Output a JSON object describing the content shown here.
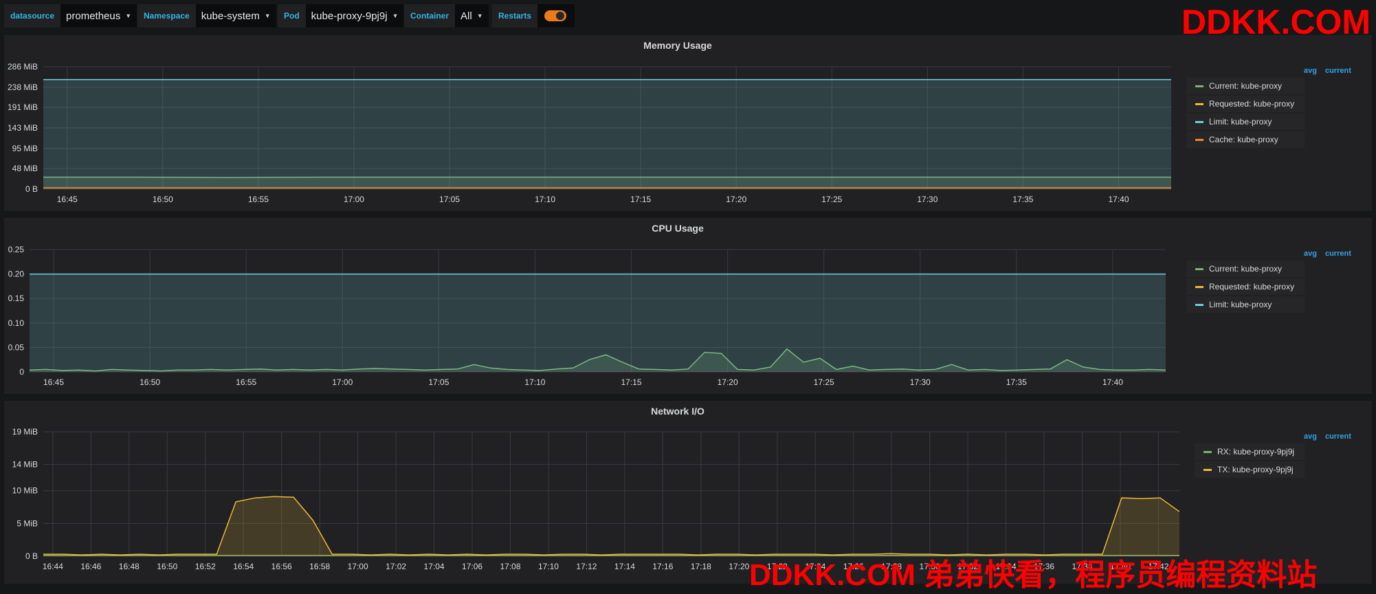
{
  "variables": {
    "datasource": {
      "label": "datasource",
      "value": "prometheus"
    },
    "namespace": {
      "label": "Namespace",
      "value": "kube-system"
    },
    "pod": {
      "label": "Pod",
      "value": "kube-proxy-9pj9j"
    },
    "container": {
      "label": "Container",
      "value": "All"
    },
    "restarts": {
      "label": "Restarts",
      "enabled": true
    }
  },
  "watermark": {
    "top": "DDKK.COM",
    "bottom": "DDKK.COM 弟弟快看，程序员编程资料站"
  },
  "legend_columns": {
    "avg": "avg",
    "current": "current"
  },
  "colors": {
    "green": "#7eb26d",
    "yellow": "#eab839",
    "blue": "#6ed0e0",
    "orange": "#ef843c",
    "accent": "#33b5e5"
  },
  "chart_data": [
    {
      "type": "line",
      "title": "Memory Usage",
      "ylim": [
        0,
        286
      ],
      "ytick_labels": [
        "0 B",
        "48 MiB",
        "95 MiB",
        "143 MiB",
        "191 MiB",
        "238 MiB",
        "286 MiB"
      ],
      "ytick_values": [
        0,
        48,
        95,
        143,
        191,
        238,
        286
      ],
      "xtick_labels": [
        "16:45",
        "16:50",
        "16:55",
        "17:00",
        "17:05",
        "17:10",
        "17:15",
        "17:20",
        "17:25",
        "17:30",
        "17:35",
        "17:40"
      ],
      "series": [
        {
          "name": "Current: kube-proxy",
          "color": "#7eb26d",
          "values": [
            28,
            28,
            27,
            28,
            28,
            28,
            28,
            28,
            28,
            28,
            28,
            28,
            28
          ]
        },
        {
          "name": "Requested: kube-proxy",
          "color": "#eab839",
          "values": []
        },
        {
          "name": "Limit: kube-proxy",
          "color": "#6ed0e0",
          "values": [
            256,
            256,
            256,
            256,
            256,
            256,
            256,
            256,
            256,
            256,
            256,
            256,
            256
          ]
        },
        {
          "name": "Cache: kube-proxy",
          "color": "#ef843c",
          "values": [
            3,
            3,
            3,
            3,
            3,
            3,
            3,
            3,
            3,
            3,
            3,
            3,
            3
          ]
        }
      ]
    },
    {
      "type": "line",
      "title": "CPU Usage",
      "ylim": [
        0,
        0.25
      ],
      "ytick_labels": [
        "0",
        "0.05",
        "0.10",
        "0.15",
        "0.20",
        "0.25"
      ],
      "ytick_values": [
        0,
        0.05,
        0.1,
        0.15,
        0.2,
        0.25
      ],
      "xtick_labels": [
        "16:45",
        "16:50",
        "16:55",
        "17:00",
        "17:05",
        "17:10",
        "17:15",
        "17:20",
        "17:25",
        "17:30",
        "17:35",
        "17:40"
      ],
      "series": [
        {
          "name": "Current: kube-proxy",
          "color": "#7eb26d",
          "values": [
            0.004,
            0.005,
            0.003,
            0.004,
            0.002,
            0.005,
            0.004,
            0.003,
            0.002,
            0.004,
            0.004,
            0.005,
            0.004,
            0.005,
            0.006,
            0.004,
            0.005,
            0.004,
            0.005,
            0.004,
            0.006,
            0.007,
            0.006,
            0.005,
            0.004,
            0.005,
            0.006,
            0.015,
            0.008,
            0.005,
            0.004,
            0.003,
            0.006,
            0.008,
            0.025,
            0.035,
            0.02,
            0.006,
            0.005,
            0.004,
            0.006,
            0.04,
            0.038,
            0.005,
            0.004,
            0.01,
            0.047,
            0.02,
            0.028,
            0.005,
            0.012,
            0.004,
            0.005,
            0.006,
            0.004,
            0.005,
            0.015,
            0.004,
            0.005,
            0.003,
            0.004,
            0.005,
            0.006,
            0.025,
            0.01,
            0.005,
            0.004,
            0.004,
            0.005,
            0.004
          ]
        },
        {
          "name": "Requested: kube-proxy",
          "color": "#eab839",
          "values": []
        },
        {
          "name": "Limit: kube-proxy",
          "color": "#6ed0e0",
          "values": [
            0.2,
            0.2,
            0.2,
            0.2,
            0.2,
            0.2,
            0.2,
            0.2,
            0.2,
            0.2,
            0.2,
            0.2,
            0.2
          ]
        }
      ]
    },
    {
      "type": "area",
      "title": "Network I/O",
      "ylim": [
        0,
        19
      ],
      "ytick_labels": [
        "0 B",
        "5 MiB",
        "10 MiB",
        "14 MiB",
        "19 MiB"
      ],
      "ytick_values": [
        0,
        5,
        10,
        14,
        19
      ],
      "xtick_labels": [
        "16:44",
        "16:46",
        "16:48",
        "16:50",
        "16:52",
        "16:54",
        "16:56",
        "16:58",
        "17:00",
        "17:02",
        "17:04",
        "17:06",
        "17:08",
        "17:10",
        "17:12",
        "17:14",
        "17:16",
        "17:18",
        "17:20",
        "17:22",
        "17:24",
        "17:26",
        "17:28",
        "17:30",
        "17:32",
        "17:34",
        "17:36",
        "17:38",
        "17:40",
        "17:42"
      ],
      "series": [
        {
          "name": "RX: kube-proxy-9pj9j",
          "color": "#7eb26d",
          "values": [
            0.1,
            0.1,
            0.1,
            0.1,
            0.1,
            0.1,
            0.1,
            0.1,
            0.1,
            0.1,
            0.1,
            0.1,
            0.1,
            0.1,
            0.1,
            0.1,
            0.1,
            0.1,
            0.1,
            0.1,
            0.1,
            0.1,
            0.1,
            0.1,
            0.1,
            0.1,
            0.1,
            0.1,
            0.1,
            0.1,
            0.1,
            0.1,
            0.1,
            0.1,
            0.1,
            0.1,
            0.1,
            0.1,
            0.1,
            0.1,
            0.1,
            0.1,
            0.1,
            0.1,
            0.1,
            0.1,
            0.1,
            0.1,
            0.1,
            0.1,
            0.1,
            0.1,
            0.1,
            0.1,
            0.1,
            0.1,
            0.1,
            0.1,
            0.1,
            0.1
          ]
        },
        {
          "name": "TX: kube-proxy-9pj9j",
          "color": "#eab839",
          "values": [
            0.3,
            0.3,
            0.2,
            0.3,
            0.2,
            0.3,
            0.2,
            0.3,
            0.3,
            0.3,
            8.3,
            8.9,
            9.1,
            9.0,
            5.5,
            0.3,
            0.3,
            0.2,
            0.3,
            0.2,
            0.3,
            0.2,
            0.3,
            0.2,
            0.3,
            0.3,
            0.2,
            0.3,
            0.3,
            0.2,
            0.3,
            0.3,
            0.3,
            0.3,
            0.2,
            0.3,
            0.3,
            0.2,
            0.3,
            0.3,
            0.3,
            0.2,
            0.3,
            0.3,
            0.4,
            0.3,
            0.3,
            0.2,
            0.3,
            0.2,
            0.3,
            0.3,
            0.2,
            0.3,
            0.3,
            0.3,
            8.9,
            8.8,
            8.9,
            6.8
          ]
        }
      ]
    }
  ]
}
